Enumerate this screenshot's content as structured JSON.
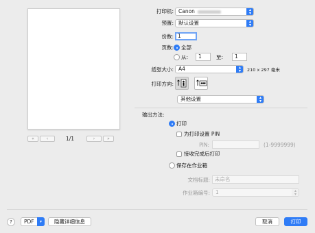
{
  "preview": {
    "page_indicator": "1/1",
    "first_label": "«",
    "prev_label": "‹",
    "next_label": "›",
    "last_label": "»"
  },
  "printer": {
    "label": "打印机:",
    "value": "Canon"
  },
  "presets": {
    "label": "预置:",
    "value": "默认设置"
  },
  "copies": {
    "label": "份数:",
    "value": "1"
  },
  "pages": {
    "label": "页数:",
    "all_label": "全部",
    "from_label": "从:",
    "from_value": "1",
    "to_label": "至:",
    "to_value": "1"
  },
  "paper_size": {
    "label": "纸张大小:",
    "value": "A4",
    "dimensions": "210 x 297 毫米"
  },
  "orientation": {
    "label": "打印方向:"
  },
  "section": {
    "value": "其他设置"
  },
  "output_method": {
    "label": "输出方法:",
    "print_label": "打印",
    "set_pin_label": "为打印设置 PIN",
    "pin_label": "PIN:",
    "pin_range": "(1-9999999)",
    "print_after_receive_label": "接收完成后打印",
    "store_label": "保存在作业箱",
    "doc_title_label": "文档标题:",
    "doc_title_value": "未命名",
    "box_number_label": "作业箱编号:",
    "box_number_value": "1"
  },
  "footer": {
    "help_label": "?",
    "pdf_label": "PDF",
    "hide_details_label": "隐藏详细信息",
    "cancel_label": "取消",
    "print_label": "打印"
  },
  "colors": {
    "accent": "#2f7cf6"
  }
}
